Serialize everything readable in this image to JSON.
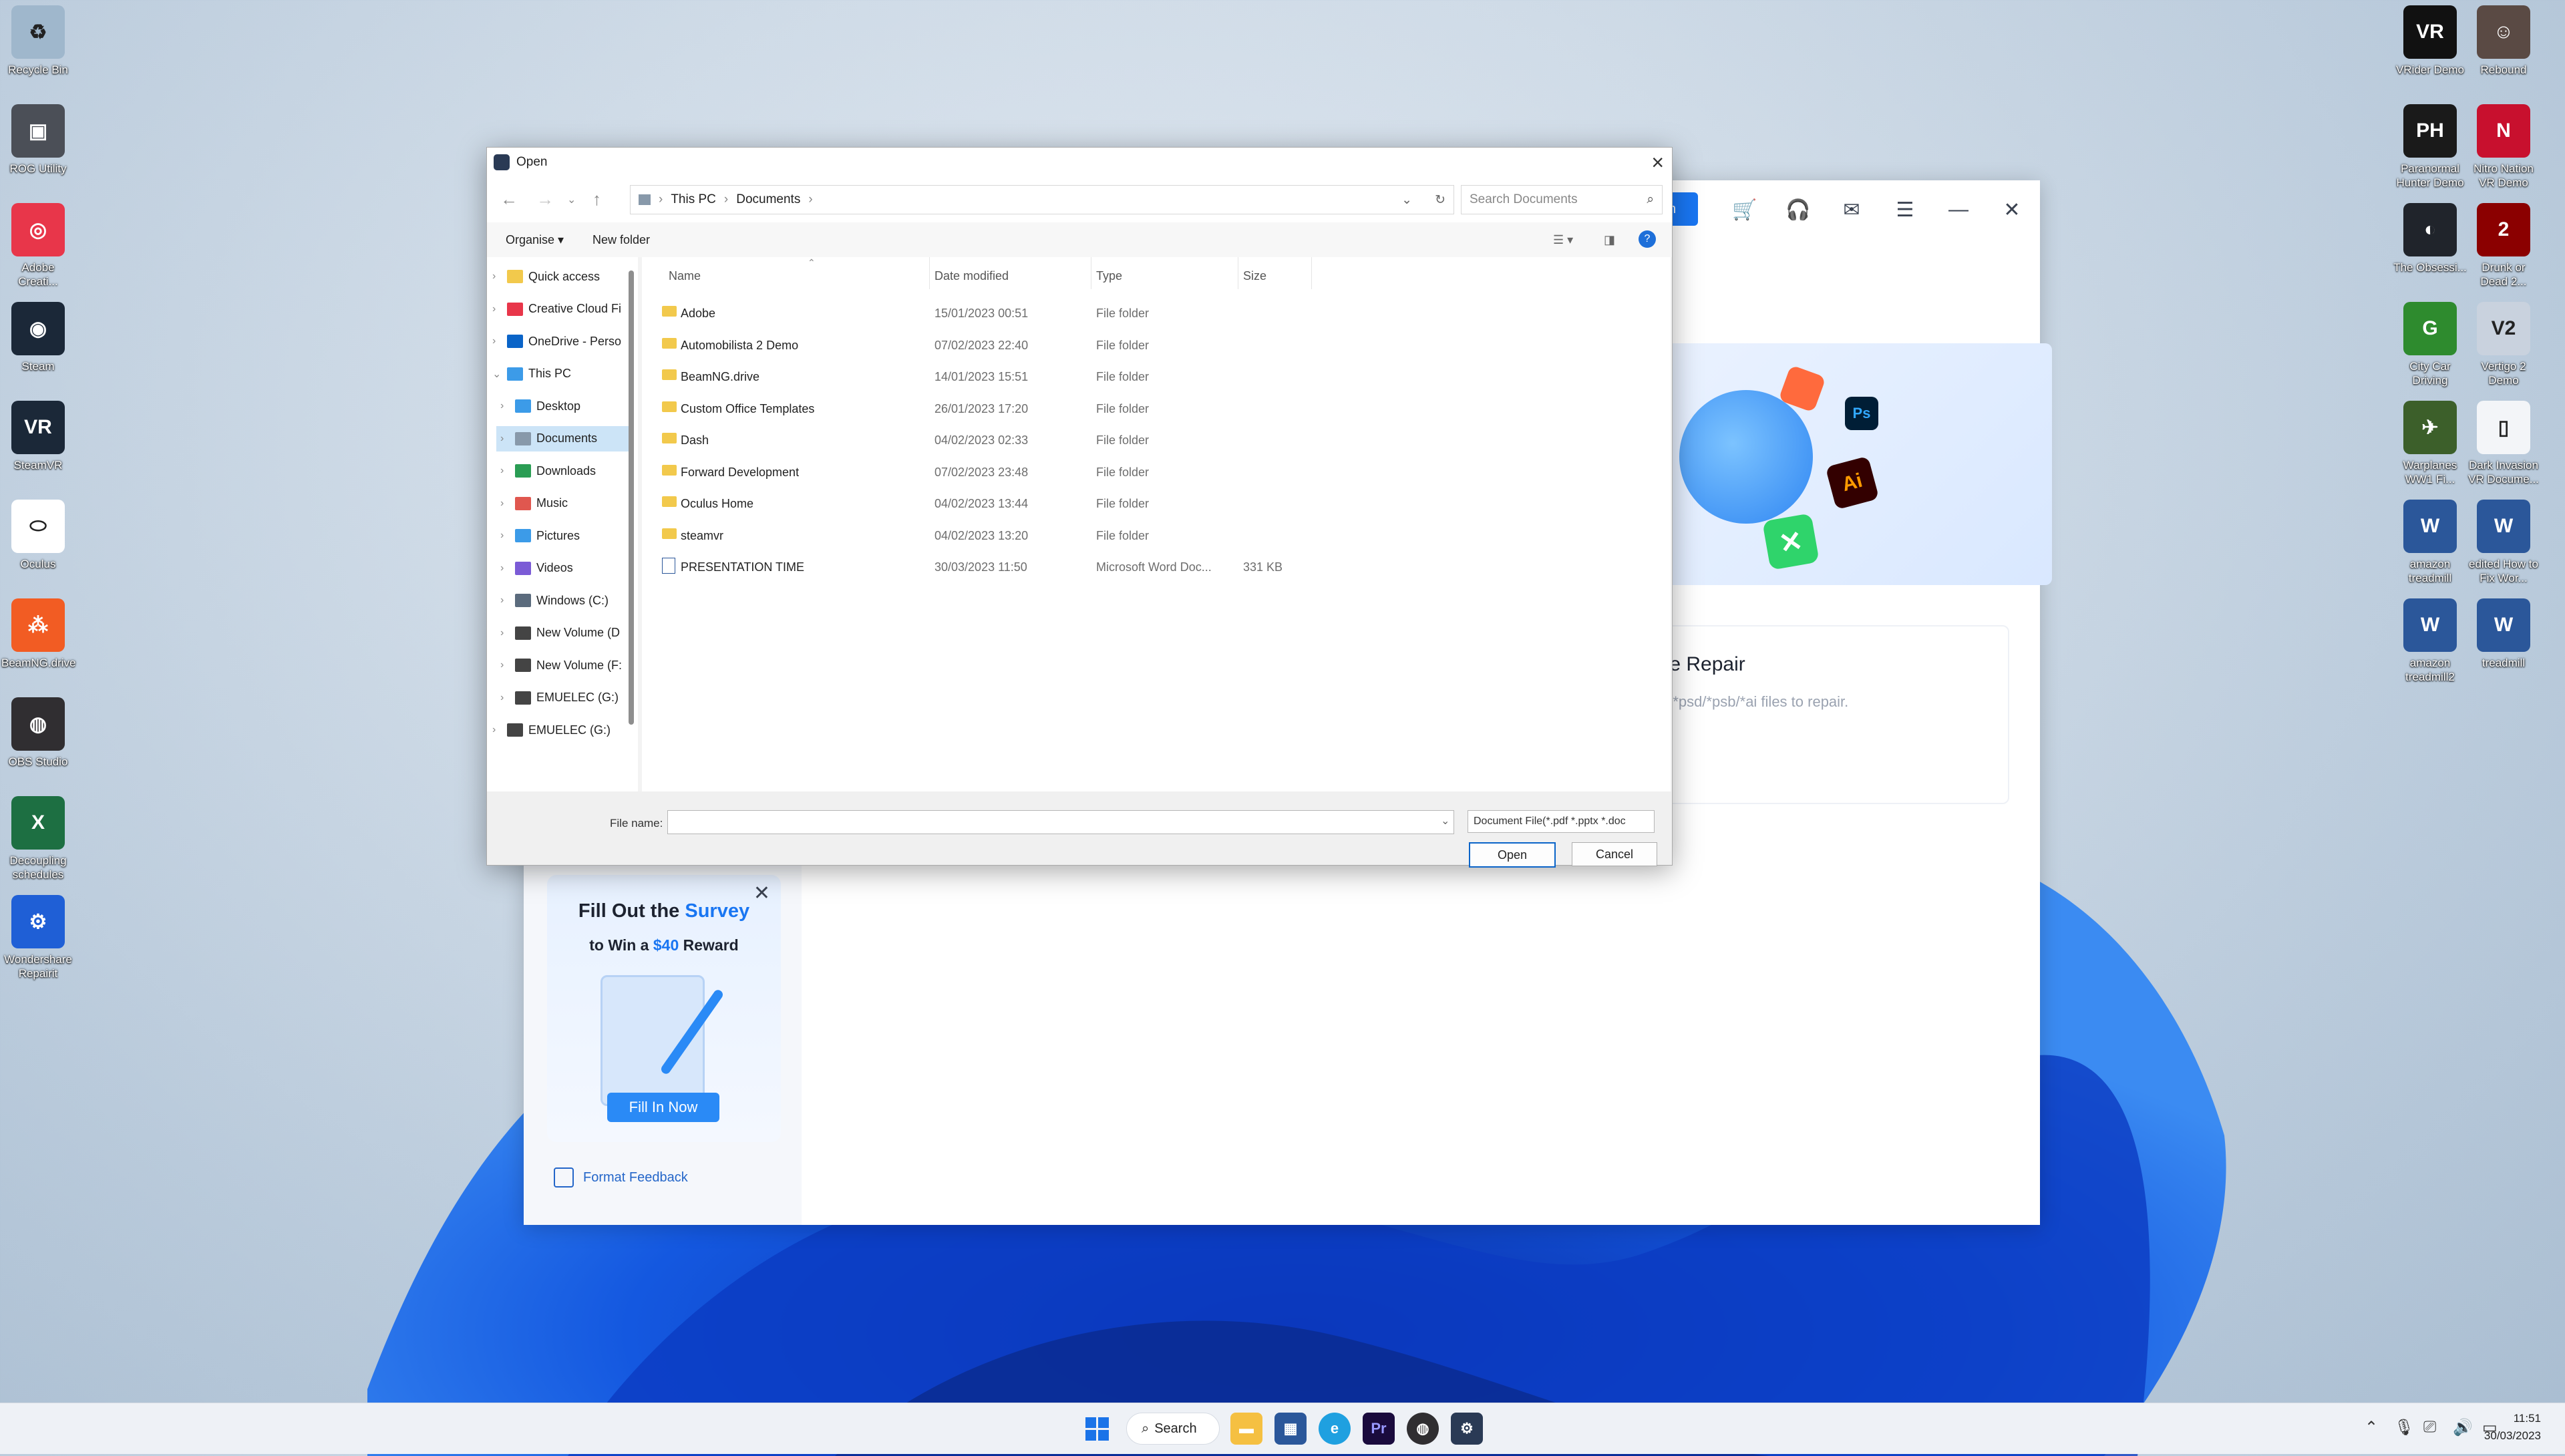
{
  "desktop": {
    "left_icons": [
      {
        "label": "Recycle Bin",
        "color": "#9fb7cc",
        "glyph": "♻"
      },
      {
        "label": "ROG Utility",
        "color": "#4b4f57",
        "glyph": "▣"
      },
      {
        "label": "Adobe Creati...",
        "color": "#e8364a",
        "glyph": "◎"
      },
      {
        "label": "Steam",
        "color": "#1b2838",
        "glyph": "◉"
      },
      {
        "label": "SteamVR",
        "color": "#1b2838",
        "glyph": "VR"
      },
      {
        "label": "Oculus",
        "color": "#ffffff",
        "glyph": "⬭"
      },
      {
        "label": "BeamNG.drive",
        "color": "#f25c23",
        "glyph": "⁂"
      },
      {
        "label": "OBS Studio",
        "color": "#302e31",
        "glyph": "◍"
      },
      {
        "label": "Decoupling schedules",
        "color": "#1d6f42",
        "glyph": "X"
      },
      {
        "label": "Wondershare Repairit",
        "color": "#1f5fd6",
        "glyph": "⚙"
      }
    ],
    "right_icons": [
      {
        "label": "VRider Demo",
        "color": "#111111",
        "glyph": "VR"
      },
      {
        "label": "Rebound",
        "color": "#5a4a44",
        "glyph": "☺"
      },
      {
        "label": "Paranormal Hunter Demo",
        "color": "#1a1a1a",
        "glyph": "PH"
      },
      {
        "label": "Nitro Nation VR Demo",
        "color": "#c8102e",
        "glyph": "N"
      },
      {
        "label": "The Obsessi...",
        "color": "#20242b",
        "glyph": "◐"
      },
      {
        "label": "Drunk or Dead 2...",
        "color": "#8b0000",
        "glyph": "2"
      },
      {
        "label": "City Car Driving",
        "color": "#2e8b2e",
        "glyph": "G"
      },
      {
        "label": "Vertigo 2 Demo",
        "color": "#c9d2de",
        "glyph": "V2"
      },
      {
        "label": "Warplanes WW1 Fi...",
        "color": "#3c5f2a",
        "glyph": "✈"
      },
      {
        "label": "Dark Invasion VR Docume...",
        "color": "#f3f5f8",
        "glyph": "▯"
      },
      {
        "label": "amazon treadmill",
        "color": "#2b579a",
        "glyph": "W"
      },
      {
        "label": "edited How to Fix Wor...",
        "color": "#2b579a",
        "glyph": "W"
      },
      {
        "label": "amazon treadmill2",
        "color": "#2b579a",
        "glyph": "W"
      },
      {
        "label": "treadmill",
        "color": "#2b579a",
        "glyph": "W"
      }
    ]
  },
  "app": {
    "hero_badges": [
      "Ps",
      "Ai"
    ],
    "card_title": "ile Repair",
    "card_sub": "d *psd/*psb/*ai files to repair.",
    "survey_title_a": "Fill Out the ",
    "survey_title_b": "Survey",
    "survey_sub_a": "to Win a ",
    "survey_sub_b": "$40",
    "survey_sub_c": " Reward",
    "survey_button": "Fill In Now",
    "feedback": "Format Feedback",
    "accent": "#1976f2"
  },
  "dialog": {
    "title": "Open",
    "path_a": "This PC",
    "path_b": "Documents",
    "search_placeholder": "Search Documents",
    "organise": "Organise ▾",
    "new_folder": "New folder",
    "nav": [
      {
        "label": "Quick access",
        "color": "#f2c94c",
        "indent": 0,
        "chev": "›",
        "selected": false
      },
      {
        "label": "Creative Cloud Fi",
        "color": "#e8364a",
        "indent": 0,
        "chev": "›",
        "selected": false
      },
      {
        "label": "OneDrive - Perso",
        "color": "#0a64c8",
        "indent": 0,
        "chev": "›",
        "selected": false
      },
      {
        "label": "This PC",
        "color": "#3c9be8",
        "indent": 0,
        "chev": "⌄",
        "selected": false
      },
      {
        "label": "Desktop",
        "color": "#3c9be8",
        "indent": 1,
        "chev": "›",
        "selected": false
      },
      {
        "label": "Documents",
        "color": "#8899aa",
        "indent": 1,
        "chev": "›",
        "selected": true
      },
      {
        "label": "Downloads",
        "color": "#2a9d54",
        "indent": 1,
        "chev": "›",
        "selected": false
      },
      {
        "label": "Music",
        "color": "#e0574f",
        "indent": 1,
        "chev": "›",
        "selected": false
      },
      {
        "label": "Pictures",
        "color": "#3c9be8",
        "indent": 1,
        "chev": "›",
        "selected": false
      },
      {
        "label": "Videos",
        "color": "#7b5bd6",
        "indent": 1,
        "chev": "›",
        "selected": false
      },
      {
        "label": "Windows (C:)",
        "color": "#5b6b7d",
        "indent": 1,
        "chev": "›",
        "selected": false
      },
      {
        "label": "New Volume (D",
        "color": "#444444",
        "indent": 1,
        "chev": "›",
        "selected": false
      },
      {
        "label": "New Volume (F:",
        "color": "#444444",
        "indent": 1,
        "chev": "›",
        "selected": false
      },
      {
        "label": "EMUELEC (G:)",
        "color": "#444444",
        "indent": 1,
        "chev": "›",
        "selected": false
      },
      {
        "label": "EMUELEC (G:)",
        "color": "#444444",
        "indent": 0,
        "chev": "›",
        "selected": false
      }
    ],
    "columns": {
      "name": "Name",
      "date": "Date modified",
      "type": "Type",
      "size": "Size"
    },
    "files": [
      {
        "name": "Adobe",
        "date": "15/01/2023 00:51",
        "type": "File folder",
        "size": "",
        "kind": "folder"
      },
      {
        "name": "Automobilista 2 Demo",
        "date": "07/02/2023 22:40",
        "type": "File folder",
        "size": "",
        "kind": "folder"
      },
      {
        "name": "BeamNG.drive",
        "date": "14/01/2023 15:51",
        "type": "File folder",
        "size": "",
        "kind": "folder"
      },
      {
        "name": "Custom Office Templates",
        "date": "26/01/2023 17:20",
        "type": "File folder",
        "size": "",
        "kind": "folder"
      },
      {
        "name": "Dash",
        "date": "04/02/2023 02:33",
        "type": "File folder",
        "size": "",
        "kind": "folder"
      },
      {
        "name": "Forward Development",
        "date": "07/02/2023 23:48",
        "type": "File folder",
        "size": "",
        "kind": "folder"
      },
      {
        "name": "Oculus Home",
        "date": "04/02/2023 13:44",
        "type": "File folder",
        "size": "",
        "kind": "folder"
      },
      {
        "name": "steamvr",
        "date": "04/02/2023 13:20",
        "type": "File folder",
        "size": "",
        "kind": "folder"
      },
      {
        "name": "PRESENTATION TIME",
        "date": "30/03/2023 11:50",
        "type": "Microsoft Word Doc...",
        "size": "331 KB",
        "kind": "word"
      }
    ],
    "file_name_label": "File name:",
    "file_name_value": "",
    "file_type": "Document File(*.pdf *.pptx *.doc",
    "open_button": "Open",
    "cancel_button": "Cancel"
  },
  "taskbar": {
    "search": "Search",
    "time": "11:51",
    "date": "30/03/2023"
  }
}
